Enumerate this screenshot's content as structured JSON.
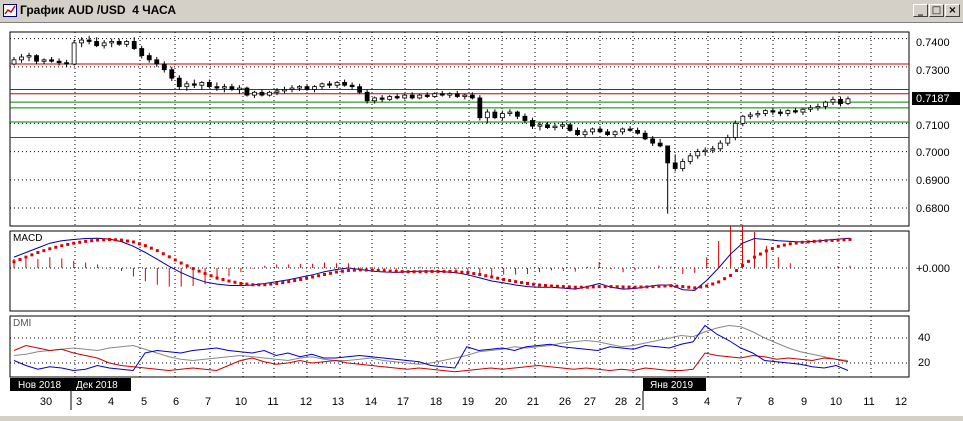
{
  "window": {
    "title": "График AUD /USD  4 ЧАСА",
    "minimize_label": "_",
    "restore_label": "□",
    "close_label": "×"
  },
  "colors": {
    "price_bars": "#000000",
    "resistance_lines": "#cc0000",
    "support_lines": "#008000",
    "grid": "#000000",
    "macd_line": "#0000aa",
    "signal_line": "#dd0000",
    "histogram": "#dd0000",
    "dmi_plus": "#0000cc",
    "dmi_minus": "#cc0000",
    "adx": "#888888",
    "current_price_bg": "#000000",
    "current_price_text": "#ffffff"
  },
  "price_panel": {
    "y_labels": [
      "0.7400",
      "0.7300",
      "0.7187",
      "0.7100",
      "0.7000",
      "0.6900",
      "0.6800"
    ],
    "current_price": "0.7187",
    "resistance_levels": [
      0.731,
      0.722,
      0.7205
    ],
    "support_levels": [
      0.7175,
      0.7155,
      0.7105,
      0.705
    ]
  },
  "macd_panel": {
    "label": "MACD",
    "y_label": "+0.000"
  },
  "dmi_panel": {
    "label": "DMI",
    "y_labels": [
      "40",
      "20"
    ]
  },
  "x_axis": {
    "month_labels": [
      "Нов 2018",
      "Дек 2018",
      "Янв 2019"
    ],
    "day_labels": [
      "30",
      "3",
      "4",
      "5",
      "6",
      "7",
      "10",
      "11",
      "12",
      "13",
      "14",
      "17",
      "18",
      "19",
      "20",
      "21",
      "26",
      "27",
      "28",
      "2",
      "3",
      "4",
      "7",
      "8",
      "9",
      "10",
      "11",
      "12"
    ]
  },
  "chart_data": {
    "type": "candlestick",
    "symbol": "AUD /USD",
    "timeframe": "4 ЧАСА",
    "y_range": [
      0.674,
      0.742
    ],
    "candles": [
      [
        0.731,
        0.7335,
        0.7305,
        0.7325
      ],
      [
        0.7325,
        0.7345,
        0.7315,
        0.7335
      ],
      [
        0.7335,
        0.735,
        0.732,
        0.734
      ],
      [
        0.734,
        0.7345,
        0.731,
        0.732
      ],
      [
        0.732,
        0.733,
        0.731,
        0.7325
      ],
      [
        0.7325,
        0.7335,
        0.7315,
        0.732
      ],
      [
        0.732,
        0.733,
        0.7305,
        0.7315
      ],
      [
        0.7315,
        0.7325,
        0.73,
        0.731
      ],
      [
        0.731,
        0.7395,
        0.7305,
        0.7385
      ],
      [
        0.7385,
        0.7405,
        0.737,
        0.7395
      ],
      [
        0.7395,
        0.741,
        0.738,
        0.739
      ],
      [
        0.739,
        0.7405,
        0.737,
        0.7375
      ],
      [
        0.7375,
        0.7395,
        0.7365,
        0.7385
      ],
      [
        0.7385,
        0.74,
        0.737,
        0.739
      ],
      [
        0.739,
        0.74,
        0.7375,
        0.738
      ],
      [
        0.738,
        0.7395,
        0.737,
        0.739
      ],
      [
        0.739,
        0.7405,
        0.736,
        0.7365
      ],
      [
        0.7365,
        0.7375,
        0.733,
        0.734
      ],
      [
        0.734,
        0.735,
        0.7315,
        0.7325
      ],
      [
        0.7325,
        0.7335,
        0.73,
        0.731
      ],
      [
        0.731,
        0.732,
        0.728,
        0.729
      ],
      [
        0.729,
        0.73,
        0.725,
        0.726
      ],
      [
        0.726,
        0.727,
        0.722,
        0.723
      ],
      [
        0.723,
        0.725,
        0.7215,
        0.724
      ],
      [
        0.724,
        0.7255,
        0.7225,
        0.7235
      ],
      [
        0.7235,
        0.725,
        0.722,
        0.7245
      ],
      [
        0.7245,
        0.7255,
        0.7225,
        0.723
      ],
      [
        0.723,
        0.7245,
        0.7215,
        0.7225
      ],
      [
        0.7225,
        0.724,
        0.721,
        0.723
      ],
      [
        0.723,
        0.724,
        0.7215,
        0.722
      ],
      [
        0.722,
        0.7235,
        0.7205,
        0.7225
      ],
      [
        0.7225,
        0.723,
        0.7195,
        0.72
      ],
      [
        0.72,
        0.7215,
        0.719,
        0.721
      ],
      [
        0.721,
        0.722,
        0.7195,
        0.72
      ],
      [
        0.72,
        0.7215,
        0.7195,
        0.721
      ],
      [
        0.721,
        0.7225,
        0.72,
        0.7215
      ],
      [
        0.7215,
        0.723,
        0.7205,
        0.722
      ],
      [
        0.722,
        0.7235,
        0.721,
        0.7225
      ],
      [
        0.7225,
        0.7235,
        0.7215,
        0.723
      ],
      [
        0.723,
        0.724,
        0.7215,
        0.722
      ],
      [
        0.722,
        0.7235,
        0.721,
        0.723
      ],
      [
        0.723,
        0.7245,
        0.722,
        0.724
      ],
      [
        0.724,
        0.725,
        0.7225,
        0.7235
      ],
      [
        0.7235,
        0.725,
        0.7225,
        0.7245
      ],
      [
        0.7245,
        0.7255,
        0.723,
        0.7235
      ],
      [
        0.7235,
        0.7245,
        0.722,
        0.723
      ],
      [
        0.723,
        0.724,
        0.7205,
        0.721
      ],
      [
        0.721,
        0.722,
        0.717,
        0.718
      ],
      [
        0.718,
        0.7195,
        0.717,
        0.719
      ],
      [
        0.719,
        0.72,
        0.7175,
        0.7185
      ],
      [
        0.7185,
        0.72,
        0.718,
        0.7195
      ],
      [
        0.7195,
        0.7205,
        0.7185,
        0.719
      ],
      [
        0.719,
        0.7205,
        0.7185,
        0.72
      ],
      [
        0.72,
        0.721,
        0.7185,
        0.719
      ],
      [
        0.719,
        0.7205,
        0.7185,
        0.72
      ],
      [
        0.72,
        0.721,
        0.719,
        0.7195
      ],
      [
        0.7195,
        0.721,
        0.719,
        0.7205
      ],
      [
        0.7205,
        0.7215,
        0.7195,
        0.72
      ],
      [
        0.72,
        0.721,
        0.719,
        0.7205
      ],
      [
        0.7205,
        0.7215,
        0.719,
        0.7195
      ],
      [
        0.7195,
        0.7205,
        0.7185,
        0.72
      ],
      [
        0.72,
        0.721,
        0.7185,
        0.719
      ],
      [
        0.719,
        0.72,
        0.711,
        0.712
      ],
      [
        0.712,
        0.715,
        0.71,
        0.714
      ],
      [
        0.714,
        0.715,
        0.7115,
        0.712
      ],
      [
        0.712,
        0.7145,
        0.711,
        0.7135
      ],
      [
        0.7135,
        0.715,
        0.7125,
        0.714
      ],
      [
        0.714,
        0.7145,
        0.7115,
        0.7125
      ],
      [
        0.7125,
        0.7135,
        0.71,
        0.711
      ],
      [
        0.711,
        0.712,
        0.708,
        0.709
      ],
      [
        0.709,
        0.7105,
        0.7075,
        0.7095
      ],
      [
        0.7095,
        0.7105,
        0.708,
        0.7085
      ],
      [
        0.7085,
        0.71,
        0.7075,
        0.709
      ],
      [
        0.709,
        0.7105,
        0.708,
        0.7095
      ],
      [
        0.7095,
        0.71,
        0.707,
        0.7075
      ],
      [
        0.7075,
        0.7085,
        0.7055,
        0.706
      ],
      [
        0.706,
        0.708,
        0.705,
        0.707
      ],
      [
        0.707,
        0.7085,
        0.706,
        0.708
      ],
      [
        0.708,
        0.709,
        0.7065,
        0.707
      ],
      [
        0.707,
        0.708,
        0.7055,
        0.706
      ],
      [
        0.706,
        0.7075,
        0.705,
        0.707
      ],
      [
        0.707,
        0.7085,
        0.706,
        0.708
      ],
      [
        0.708,
        0.709,
        0.707,
        0.7075
      ],
      [
        0.7075,
        0.7085,
        0.706,
        0.7065
      ],
      [
        0.7065,
        0.7075,
        0.704,
        0.7045
      ],
      [
        0.7045,
        0.7055,
        0.702,
        0.703
      ],
      [
        0.703,
        0.7045,
        0.7015,
        0.702
      ],
      [
        0.702,
        0.697,
        0.678,
        0.696
      ],
      [
        0.696,
        0.699,
        0.693,
        0.694
      ],
      [
        0.694,
        0.6975,
        0.693,
        0.6965
      ],
      [
        0.6965,
        0.6995,
        0.6955,
        0.6985
      ],
      [
        0.6985,
        0.701,
        0.6975,
        0.7
      ],
      [
        0.7,
        0.7015,
        0.6985,
        0.7005
      ],
      [
        0.7005,
        0.702,
        0.6995,
        0.701
      ],
      [
        0.701,
        0.704,
        0.7,
        0.703
      ],
      [
        0.703,
        0.706,
        0.702,
        0.705
      ],
      [
        0.705,
        0.711,
        0.704,
        0.71
      ],
      [
        0.71,
        0.713,
        0.709,
        0.7125
      ],
      [
        0.7125,
        0.714,
        0.7115,
        0.713
      ],
      [
        0.713,
        0.7145,
        0.712,
        0.7135
      ],
      [
        0.7135,
        0.715,
        0.7125,
        0.7145
      ],
      [
        0.7145,
        0.7155,
        0.713,
        0.714
      ],
      [
        0.714,
        0.715,
        0.7125,
        0.7135
      ],
      [
        0.7135,
        0.715,
        0.7125,
        0.7145
      ],
      [
        0.7145,
        0.7155,
        0.7135,
        0.714
      ],
      [
        0.714,
        0.7155,
        0.713,
        0.715
      ],
      [
        0.715,
        0.7165,
        0.714,
        0.7155
      ],
      [
        0.7155,
        0.717,
        0.7145,
        0.716
      ],
      [
        0.716,
        0.718,
        0.715,
        0.7175
      ],
      [
        0.7175,
        0.7195,
        0.7165,
        0.7185
      ],
      [
        0.7185,
        0.7195,
        0.716,
        0.717
      ],
      [
        0.717,
        0.7195,
        0.7165,
        0.7187
      ]
    ],
    "macd_line": [
      0.35,
      0.5,
      0.65,
      0.8,
      0.88,
      0.92,
      0.95,
      0.96,
      0.93,
      0.85,
      0.7,
      0.5,
      0.28,
      0.05,
      -0.15,
      -0.32,
      -0.45,
      -0.52,
      -0.56,
      -0.57,
      -0.55,
      -0.5,
      -0.44,
      -0.38,
      -0.3,
      -0.22,
      -0.12,
      -0.05,
      0.0,
      -0.05,
      -0.1,
      -0.13,
      -0.14,
      -0.12,
      -0.1,
      -0.1,
      -0.12,
      -0.15,
      -0.22,
      -0.32,
      -0.42,
      -0.48,
      -0.55,
      -0.6,
      -0.62,
      -0.62,
      -0.65,
      -0.68,
      -0.6,
      -0.5,
      -0.62,
      -0.68,
      -0.66,
      -0.6,
      -0.55,
      -0.55,
      -0.7,
      -0.72,
      -0.4,
      0.0,
      0.45,
      0.8,
      0.95,
      0.92,
      0.88,
      0.86,
      0.84,
      0.86,
      0.9,
      0.93,
      0.96
    ],
    "signal_line": [
      0.2,
      0.35,
      0.5,
      0.62,
      0.72,
      0.8,
      0.86,
      0.9,
      0.92,
      0.9,
      0.84,
      0.72,
      0.56,
      0.36,
      0.16,
      -0.02,
      -0.18,
      -0.32,
      -0.42,
      -0.5,
      -0.54,
      -0.54,
      -0.5,
      -0.44,
      -0.37,
      -0.29,
      -0.21,
      -0.13,
      -0.08,
      -0.06,
      -0.07,
      -0.09,
      -0.11,
      -0.12,
      -0.12,
      -0.11,
      -0.11,
      -0.12,
      -0.15,
      -0.21,
      -0.29,
      -0.37,
      -0.44,
      -0.5,
      -0.55,
      -0.58,
      -0.6,
      -0.62,
      -0.62,
      -0.6,
      -0.6,
      -0.61,
      -0.62,
      -0.61,
      -0.59,
      -0.57,
      -0.6,
      -0.64,
      -0.58,
      -0.45,
      -0.24,
      0.08,
      0.35,
      0.55,
      0.7,
      0.78,
      0.83,
      0.86,
      0.88,
      0.9,
      0.92
    ],
    "dmi_plus": [
      22,
      18,
      15,
      17,
      16,
      14,
      15,
      18,
      16,
      15,
      14,
      28,
      30,
      29,
      28,
      30,
      31,
      32,
      30,
      29,
      28,
      30,
      26,
      28,
      25,
      27,
      24,
      24,
      25,
      26,
      25,
      24,
      23,
      22,
      21,
      18,
      17,
      16,
      33,
      30,
      31,
      32,
      30,
      33,
      34,
      35,
      33,
      32,
      31,
      30,
      33,
      32,
      31,
      34,
      33,
      32,
      35,
      37,
      50,
      43,
      38,
      32,
      28,
      22,
      21,
      20,
      19,
      17,
      16,
      18,
      14
    ],
    "dmi_minus": [
      30,
      34,
      32,
      30,
      31,
      28,
      26,
      24,
      20,
      18,
      17,
      16,
      15,
      14,
      15,
      16,
      15,
      14,
      18,
      22,
      24,
      21,
      19,
      20,
      22,
      20,
      21,
      22,
      20,
      19,
      18,
      17,
      16,
      15,
      16,
      15,
      14,
      13,
      14,
      15,
      16,
      15,
      16,
      17,
      18,
      17,
      16,
      15,
      16,
      15,
      14,
      15,
      14,
      16,
      15,
      14,
      14,
      15,
      28,
      26,
      25,
      24,
      26,
      25,
      23,
      24,
      23,
      22,
      24,
      23,
      21
    ],
    "adx": [
      26,
      27,
      29,
      30,
      31,
      32,
      31,
      30,
      32,
      33,
      34,
      31,
      28,
      25,
      23,
      22,
      23,
      24,
      25,
      26,
      25,
      24,
      23,
      22,
      24,
      25,
      23,
      22,
      22,
      23,
      24,
      22,
      21,
      20,
      19,
      20,
      22,
      24,
      26,
      29,
      30,
      31,
      33,
      32,
      33,
      34,
      36,
      37,
      38,
      37,
      35,
      33,
      34,
      36,
      38,
      40,
      42,
      41,
      45,
      48,
      50,
      49,
      45,
      40,
      36,
      32,
      29,
      27,
      25,
      23,
      22
    ]
  }
}
